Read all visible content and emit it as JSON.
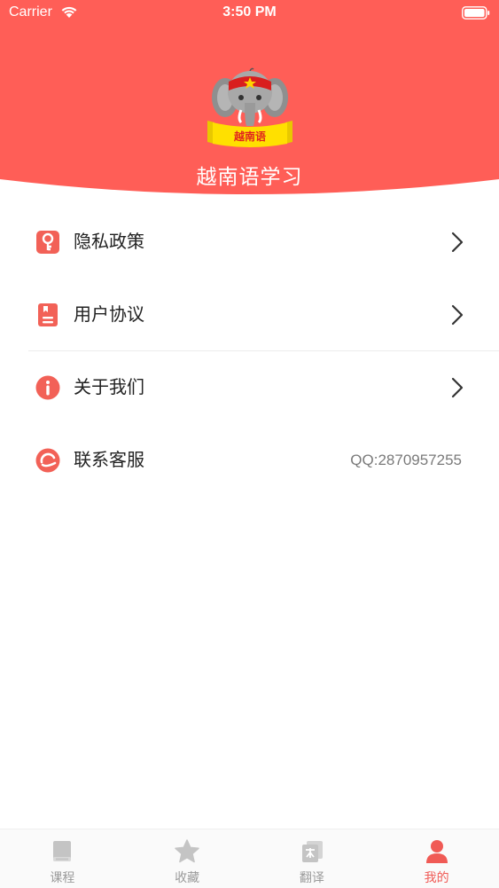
{
  "status_bar": {
    "carrier": "Carrier",
    "time": "3:50 PM"
  },
  "header": {
    "logo_text": "越南语",
    "title": "越南语学习",
    "accent_color": "#ff5e57"
  },
  "menu": {
    "items": [
      {
        "icon": "key-icon",
        "label": "隐私政策",
        "has_chevron": true
      },
      {
        "icon": "document-icon",
        "label": "用户协议",
        "has_chevron": true
      },
      {
        "icon": "info-icon",
        "label": "关于我们",
        "has_chevron": true
      },
      {
        "icon": "headset-icon",
        "label": "联系客服",
        "value": "QQ:2870957255"
      }
    ]
  },
  "tab_bar": {
    "tabs": [
      {
        "icon": "book-icon",
        "label": "课程",
        "active": false
      },
      {
        "icon": "star-icon",
        "label": "收藏",
        "active": false
      },
      {
        "icon": "translate-icon",
        "label": "翻译",
        "active": false
      },
      {
        "icon": "person-icon",
        "label": "我的",
        "active": true
      }
    ],
    "inactive_color": "#bfbfbf",
    "active_color": "#f05a55"
  }
}
